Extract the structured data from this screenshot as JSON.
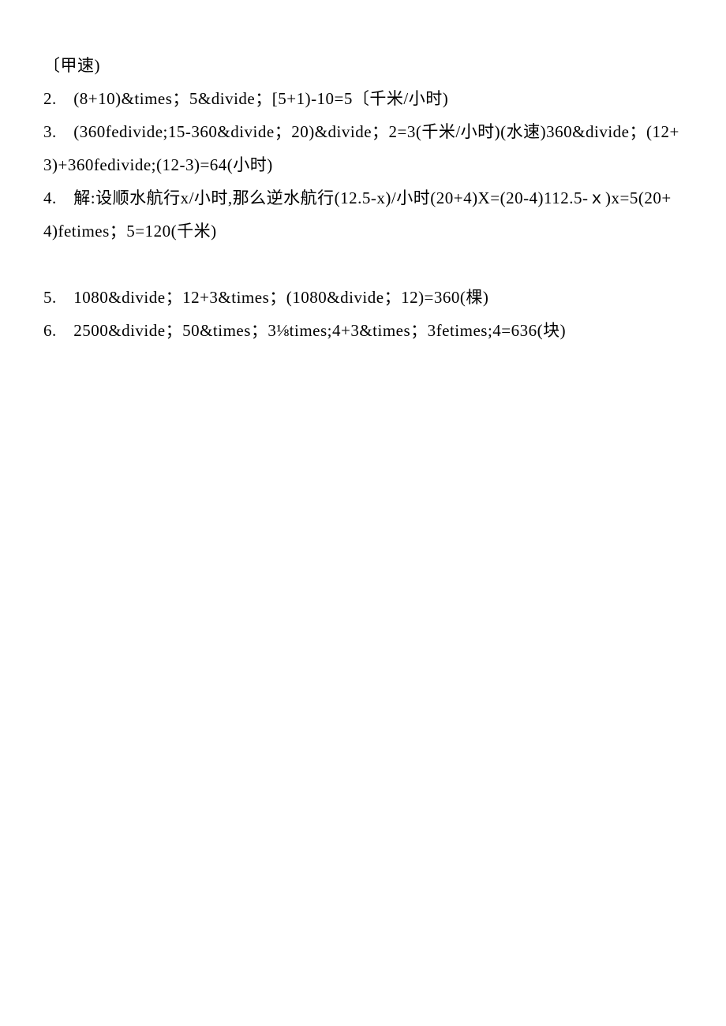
{
  "lines": {
    "l1": "〔甲速)",
    "l2": "2.　(8+10)&times；5&divide；[5+1)-10=5〔千米/小时)",
    "l3": "3.　(360fedivide;15-360&divide；20)&divide；2=3(千米/小时)(水速)360&divide；(12+3)+360fedivide;(12-3)=64(小时)",
    "l4": "4.　解:设顺水航行x/小时,那么逆水航行(12.5-x)/小时(20+4)X=(20-4)112.5-ｘ)x=5(20+4)fetimes；5=120(千米)",
    "l5": "5.　1080&divide；12+3&times；(1080&divide；12)=360(棵)",
    "l6": "6.　2500&divide；50&times；3⅛times;4+3&times；3fetimes;4=636(块)"
  }
}
